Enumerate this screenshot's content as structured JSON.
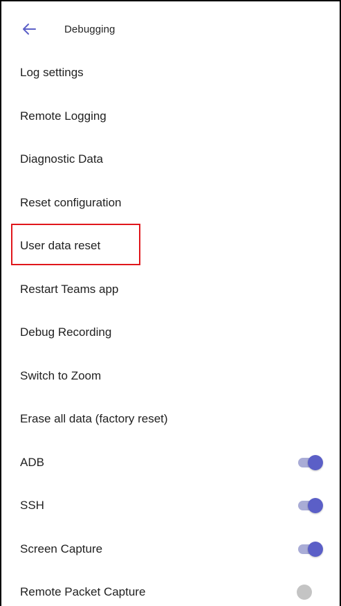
{
  "header": {
    "title": "Debugging",
    "back_icon": "arrow-left-icon"
  },
  "menu_items": [
    {
      "label": "Log settings"
    },
    {
      "label": "Remote Logging"
    },
    {
      "label": "Diagnostic Data"
    },
    {
      "label": "Reset configuration"
    },
    {
      "label": "User data reset",
      "highlighted": true
    },
    {
      "label": "Restart Teams app"
    },
    {
      "label": "Debug Recording"
    },
    {
      "label": "Switch to Zoom"
    },
    {
      "label": "Erase all data (factory reset)"
    }
  ],
  "toggles": [
    {
      "label": "ADB",
      "on": true
    },
    {
      "label": "SSH",
      "on": true
    },
    {
      "label": "Screen Capture",
      "on": true
    },
    {
      "label": "Remote Packet Capture",
      "on": false
    }
  ],
  "colors": {
    "accent": "#5b5fc7",
    "accent_track": "#a9acd6",
    "highlight_border": "#e0161b",
    "toggle_off_thumb": "#c4c4c4"
  }
}
